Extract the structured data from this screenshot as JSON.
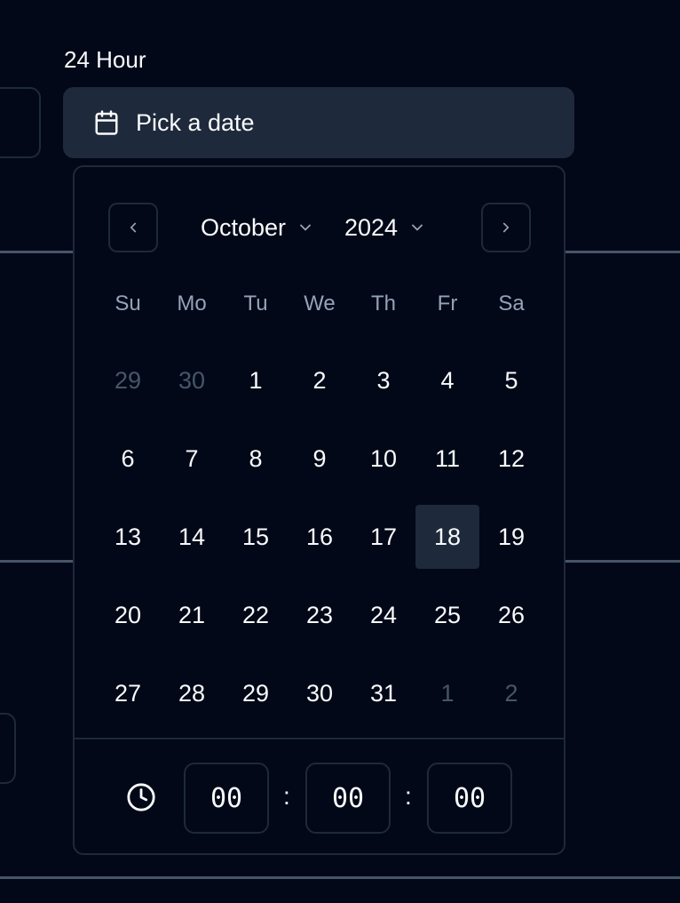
{
  "form": {
    "label": "24 Hour"
  },
  "trigger": {
    "placeholder": "Pick a date",
    "icon": "calendar-icon"
  },
  "calendar": {
    "month": "October",
    "year": "2024",
    "weekdays": [
      "Su",
      "Mo",
      "Tu",
      "We",
      "Th",
      "Fr",
      "Sa"
    ],
    "weeks": [
      [
        {
          "d": "29",
          "o": true
        },
        {
          "d": "30",
          "o": true
        },
        {
          "d": "1"
        },
        {
          "d": "2"
        },
        {
          "d": "3"
        },
        {
          "d": "4"
        },
        {
          "d": "5"
        }
      ],
      [
        {
          "d": "6"
        },
        {
          "d": "7"
        },
        {
          "d": "8"
        },
        {
          "d": "9"
        },
        {
          "d": "10"
        },
        {
          "d": "11"
        },
        {
          "d": "12"
        }
      ],
      [
        {
          "d": "13"
        },
        {
          "d": "14"
        },
        {
          "d": "15"
        },
        {
          "d": "16"
        },
        {
          "d": "17"
        },
        {
          "d": "18",
          "s": true
        },
        {
          "d": "19"
        }
      ],
      [
        {
          "d": "20"
        },
        {
          "d": "21"
        },
        {
          "d": "22"
        },
        {
          "d": "23"
        },
        {
          "d": "24"
        },
        {
          "d": "25"
        },
        {
          "d": "26"
        }
      ],
      [
        {
          "d": "27"
        },
        {
          "d": "28"
        },
        {
          "d": "29"
        },
        {
          "d": "30"
        },
        {
          "d": "31"
        },
        {
          "d": "1",
          "o": true
        },
        {
          "d": "2",
          "o": true
        }
      ]
    ],
    "selected_day": "18"
  },
  "time": {
    "hours": "00",
    "minutes": "00",
    "seconds": "00",
    "separator": ":"
  },
  "colors": {
    "background": "#020817",
    "surface": "#1e293b",
    "muted_text": "#94a3b8",
    "outside_text": "#475569",
    "foreground": "#f8fafc"
  }
}
